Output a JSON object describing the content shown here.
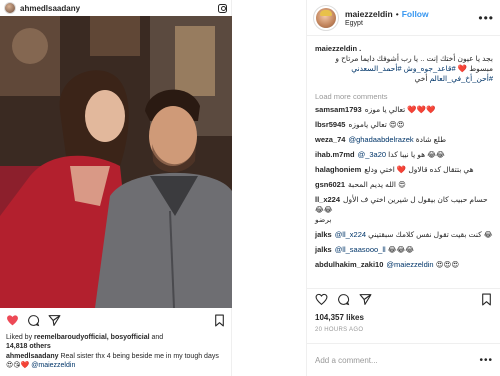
{
  "embed": {
    "username": "ahmedlsaadany",
    "liked_by_prefix": "Liked by ",
    "liked_by_users": "reemelbaroudyofficial, bosyofficial",
    "liked_by_and": " and",
    "likes_count": "14,818 others",
    "caption_user": "ahmedlsaadany",
    "caption_text": " Real sister thx 4 being beside me in my tough days 😍😘❤️ ",
    "caption_mention": "@maiezzeldin"
  },
  "detail": {
    "username": "maiezzeldin",
    "dot": "•",
    "follow_label": "Follow",
    "location": "Egypt",
    "more_label": "•••",
    "caption_user": "maiezzeldin .",
    "caption_line1": "بجد يا عيون أختك إنت .. يا رب أشوفك دايما مرتاح و",
    "caption_line2": "مبسوط ❤️",
    "caption_tags1": "#قاعد_جوه_وش",
    "caption_tags2": "#أحمد_السعدني",
    "caption_line3": "#أحن_أخ_في_العالم",
    "caption_line3b": "أخي",
    "load_more": "Load more comments",
    "comments": [
      {
        "user": "samsam1793",
        "text": "تعالي يا موزه ❤️❤️❤️"
      },
      {
        "user": "lbsr5945",
        "text": "تعالي ياموزه 😍😍"
      },
      {
        "user": "weza_74",
        "mention": "@ghadaabdelrazek",
        "text": "طلع شادة"
      },
      {
        "user": "ihab.m7md",
        "mention": "@_3a20",
        "text": "هو يا نيبا كدا 😂😂"
      },
      {
        "user": "halaghoniem",
        "text": "هي بتتقال كده قالاول ❤️ اختي ودلع"
      },
      {
        "user": "gsn6021",
        "text": "الله يديم المحبة 😍"
      },
      {
        "user": "ll_x224",
        "text": "حسام حبيب كان بيقول ل شيرين اختي ف الأول 😂😂",
        "cont": "برضو"
      },
      {
        "user": "jalks",
        "mention": "@ll_x224",
        "text": "كنت بقيت تقول نفس كلامك سبقتيني 😂"
      },
      {
        "user": "jalks",
        "mention": "@ll_saasooo_ll",
        "text": "😂😂😂"
      },
      {
        "user": "abdulhakim_zaki10",
        "mention": "@maiezzeldin",
        "text": "😍😍😍"
      }
    ],
    "likes": "104,357 likes",
    "time": "20 HOURS AGO",
    "add_comment_placeholder": "Add a comment...",
    "add_more": "•••"
  },
  "colors": {
    "link": "#003569",
    "follow": "#3897f0",
    "like_red": "#ed4956",
    "muted": "#999999"
  },
  "icons": {
    "embed_like": "heart-filled-icon",
    "embed_comment": "comment-icon",
    "embed_share": "share-icon",
    "embed_save": "bookmark-icon",
    "detail_like": "heart-icon",
    "detail_comment": "comment-icon",
    "detail_share": "share-icon",
    "detail_save": "bookmark-icon"
  }
}
